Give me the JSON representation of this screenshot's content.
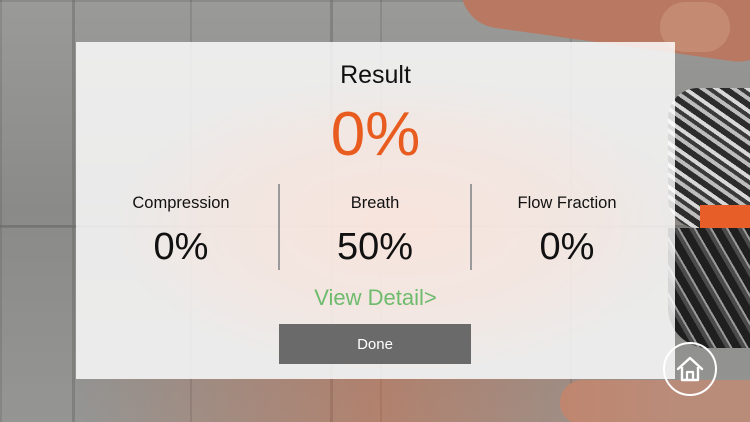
{
  "dialog": {
    "title": "Result",
    "overall_score": "0%",
    "metrics": [
      {
        "label": "Compression",
        "value": "0%"
      },
      {
        "label": "Breath",
        "value": "50%"
      },
      {
        "label": "Flow Fraction",
        "value": "0%"
      }
    ],
    "view_detail_label": "View Detail>",
    "done_label": "Done"
  },
  "home_button": {
    "icon": "home-icon"
  },
  "colors": {
    "accent": "#e85d1f",
    "link_green": "#6ebb6e",
    "button_gray": "#6a6a6a"
  }
}
